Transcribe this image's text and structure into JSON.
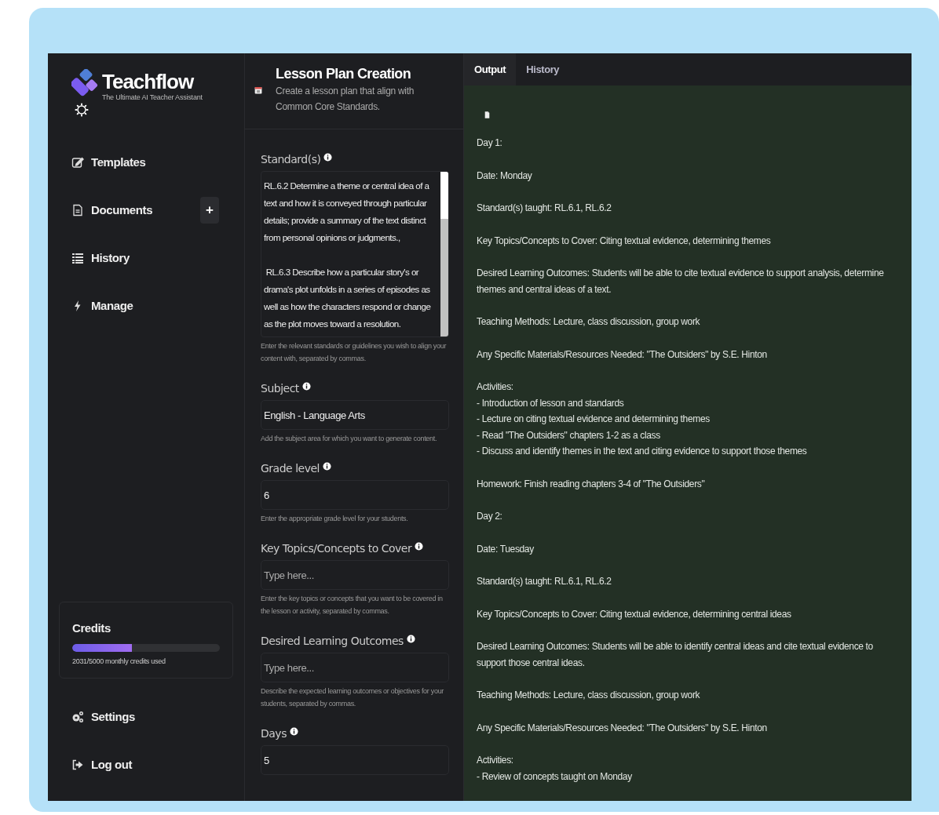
{
  "brand": {
    "name": "Teachflow",
    "tagline": "The Ultimate AI Teacher Assistant"
  },
  "nav": [
    {
      "label": "Templates",
      "kind": "edit"
    },
    {
      "label": "Documents",
      "kind": "document",
      "action": "+"
    },
    {
      "label": "History",
      "kind": "list"
    },
    {
      "label": "Manage",
      "kind": "bolt"
    }
  ],
  "credits": {
    "title": "Credits",
    "level": 0.406,
    "caption": "2031/5000 monthly credits used"
  },
  "footer_nav": [
    {
      "label": "Settings",
      "kind": "gears"
    },
    {
      "label": "Log out",
      "kind": "logout"
    }
  ],
  "tool": {
    "title": "Lesson Plan Creation",
    "description": "Create a lesson plan that align with Common Core Standards."
  },
  "fields": [
    {
      "kind": "textarea",
      "label": "Standard(s)",
      "value": "RL.6.2 Determine a theme or central idea of a text and how it is conveyed through particular details; provide a summary of the text distinct from personal opinions or judgments.,\n\n RL.6.3 Describe how a particular story's or drama's plot unfolds in a series of episodes as well as how the characters respond or change as the plot moves toward a resolution.",
      "help": "Enter the relevant standards or guidelines you wish to align your content with, separated by commas."
    },
    {
      "kind": "input",
      "label": "Subject",
      "value": "English - Language Arts",
      "help": "Add the subject area for which you want to generate content."
    },
    {
      "kind": "input",
      "label": "Grade level",
      "value": "6",
      "help": "Enter the appropriate grade level for your students."
    },
    {
      "kind": "input",
      "label": "Key Topics/Concepts to Cover",
      "placeholder": "Type here...",
      "help": "Enter the key topics or concepts that you want to be covered in the lesson or activity, separated by commas."
    },
    {
      "kind": "input",
      "label": "Desired Learning Outcomes",
      "placeholder": "Type here...",
      "help": "Describe the expected learning outcomes or objectives for your students, separated by commas."
    },
    {
      "kind": "input",
      "label": "Days",
      "value": "5"
    }
  ],
  "tabs": [
    {
      "label": "Output",
      "selected": true
    },
    {
      "label": "History",
      "selected": false
    }
  ],
  "output": [
    [
      "Day 1:"
    ],
    [
      "Date: Monday"
    ],
    [
      "Standard(s) taught: RL.6.1, RL.6.2"
    ],
    [
      "Key Topics/Concepts to Cover: Citing textual evidence, determining themes"
    ],
    [
      "Desired Learning Outcomes: Students will be able to cite textual evidence to support analysis, determine themes and central ideas of a text."
    ],
    [
      "Teaching Methods: Lecture, class discussion, group work"
    ],
    [
      "Any Specific Materials/Resources Needed: \"The Outsiders\" by S.E. Hinton"
    ],
    [
      "Activities:",
      "- Introduction of lesson and standards",
      "- Lecture on citing textual evidence and determining themes",
      "- Read \"The Outsiders\" chapters 1-2 as a class",
      "- Discuss and identify themes in the text and citing evidence to support those themes"
    ],
    [
      "Homework: Finish reading chapters 3-4 of \"The Outsiders\""
    ],
    [
      "Day 2:"
    ],
    [
      "Date: Tuesday"
    ],
    [
      "Standard(s) taught: RL.6.1, RL.6.2"
    ],
    [
      "Key Topics/Concepts to Cover: Citing textual evidence, determining central ideas"
    ],
    [
      "Desired Learning Outcomes: Students will be able to identify central ideas and cite textual evidence to support those central ideas."
    ],
    [
      "Teaching Methods: Lecture, class discussion, group work"
    ],
    [
      "Any Specific Materials/Resources Needed: \"The Outsiders\" by S.E. Hinton"
    ],
    [
      "Activities:",
      "- Review of concepts taught on Monday"
    ]
  ]
}
